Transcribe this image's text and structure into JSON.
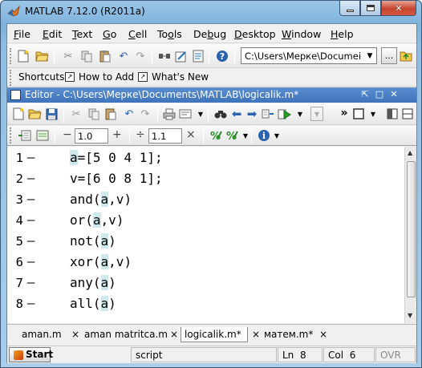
{
  "window": {
    "title": "MATLAB  7.12.0 (R2011a)"
  },
  "menu": [
    {
      "label": "File",
      "mnemonic": "F",
      "rest": "ile"
    },
    {
      "label": "Edit",
      "mnemonic": "E",
      "rest": "dit"
    },
    {
      "label": "Text",
      "mnemonic": "T",
      "rest": "ext"
    },
    {
      "label": "Go",
      "mnemonic": "G",
      "rest": "o"
    },
    {
      "label": "Cell",
      "mnemonic": "C",
      "rest": "ell"
    },
    {
      "label": "Tools",
      "pre": "To",
      "mnemonic": "o",
      "rest": "ls"
    },
    {
      "label": "Debug",
      "pre": "De",
      "mnemonic": "b",
      "rest": "ug"
    },
    {
      "label": "Desktop",
      "mnemonic": "D",
      "rest": "esktop"
    },
    {
      "label": "Window",
      "mnemonic": "W",
      "rest": "indow"
    },
    {
      "label": "Help",
      "mnemonic": "H",
      "rest": "elp"
    }
  ],
  "toolbar": {
    "current_folder": "C:\\Users\\Мерке\\Documei",
    "browse_label": "..."
  },
  "shortcuts": {
    "label": "Shortcuts",
    "how_to_add": "How to Add",
    "whats_new": "What's New"
  },
  "editor": {
    "title": "Editor - C:\\Users\\Мерке\\Documents\\MATLAB\\logicalik.m*",
    "cell_values": {
      "decrement_symbol": "−",
      "value1": "1.0",
      "increment_symbol": "+",
      "divide_symbol": "÷",
      "value2": "1.1",
      "multiply_symbol": "×"
    },
    "lines": [
      {
        "num": "1",
        "pre": "",
        "hl": "a",
        "post": "=[5 0 4 1];"
      },
      {
        "num": "2",
        "pre": "v=[6 0 8 1];",
        "hl": "",
        "post": ""
      },
      {
        "num": "3",
        "pre": "and(",
        "hl": "a",
        "post": ",v)"
      },
      {
        "num": "4",
        "pre": "or(",
        "hl": "a",
        "post": ",v)"
      },
      {
        "num": "5",
        "pre": "not(",
        "hl": "a",
        "post": ")"
      },
      {
        "num": "6",
        "pre": "xor(",
        "hl": "a",
        "post": ",v)"
      },
      {
        "num": "7",
        "pre": "any(",
        "hl": "a",
        "post": ")"
      },
      {
        "num": "8",
        "pre": "all(",
        "hl": "a",
        "post": ")"
      }
    ],
    "breakpoint_marker": "—",
    "tabs": [
      {
        "label": "aman.m",
        "active": false
      },
      {
        "label": "aman matritca.m",
        "active": false
      },
      {
        "label": "logicalik.m*",
        "active": true
      },
      {
        "label": "матем.m*",
        "active": false
      }
    ],
    "tab_close": "×"
  },
  "status": {
    "start_label": "Start",
    "mode": "script",
    "ln_label": "Ln",
    "ln_value": "8",
    "col_label": "Col",
    "col_value": "6",
    "ovr": "OVR"
  },
  "colors": {
    "highlight": "#cfe8eb",
    "titlebar_editor": "#4a7fc5"
  }
}
